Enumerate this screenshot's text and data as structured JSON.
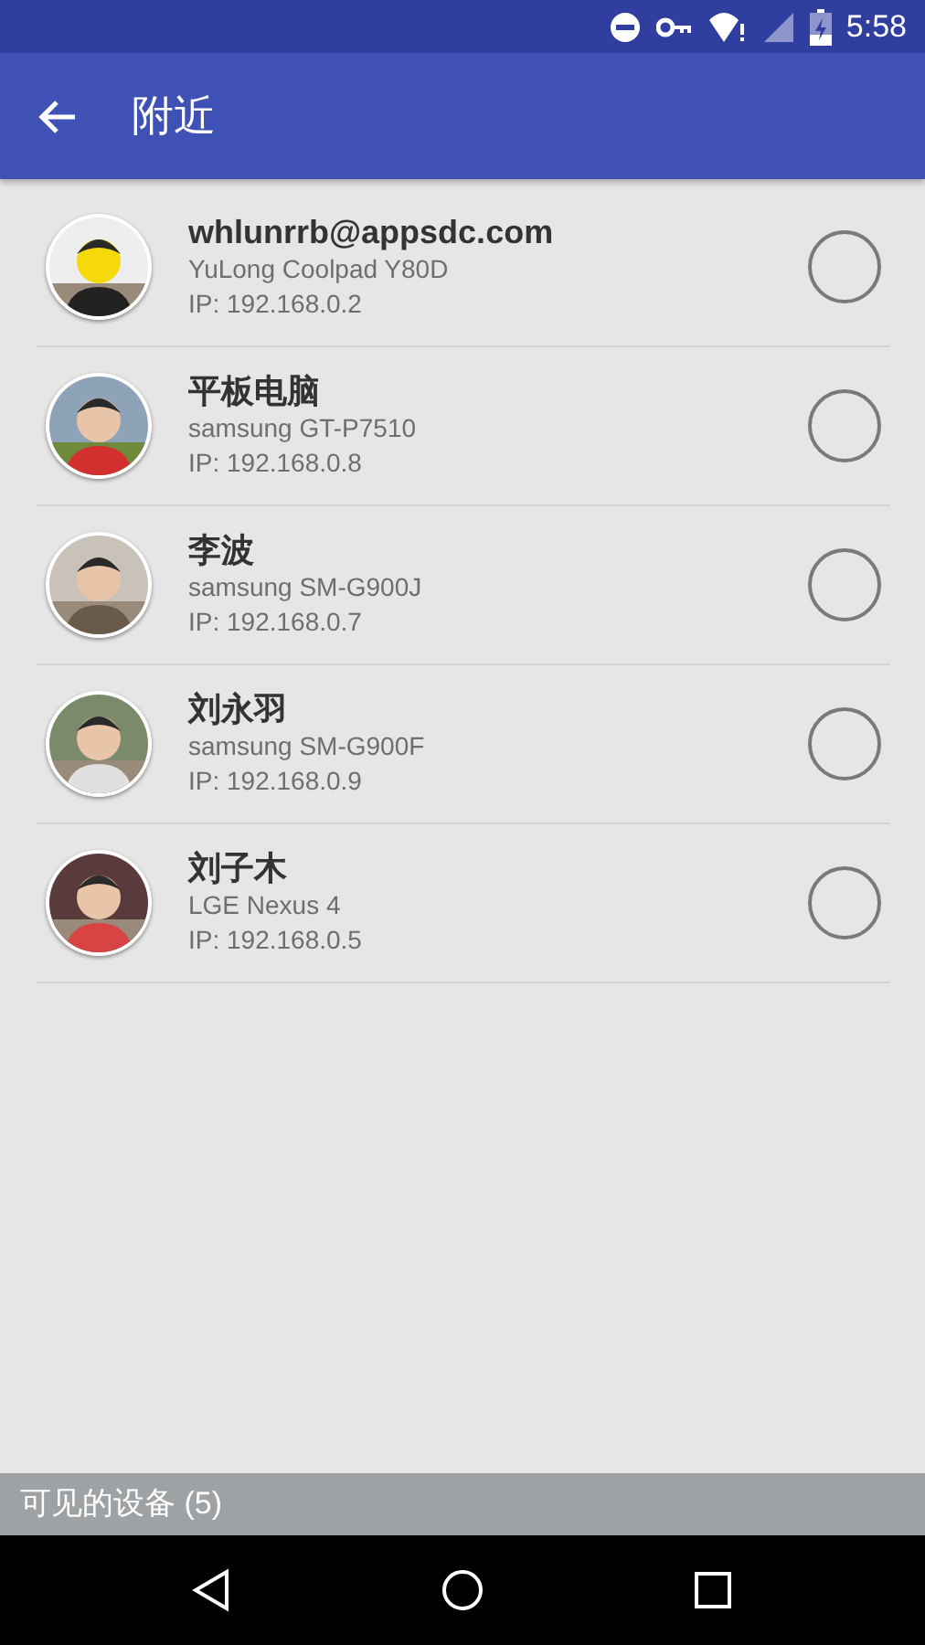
{
  "status_bar": {
    "time": "5:58"
  },
  "app_bar": {
    "title": "附近"
  },
  "devices": [
    {
      "name": "whlunrrb@appsdc.com",
      "model": "YuLong Coolpad Y80D",
      "ip": "IP: 192.168.0.2",
      "selected": false
    },
    {
      "name": "平板电脑",
      "model": "samsung GT-P7510",
      "ip": "IP: 192.168.0.8",
      "selected": false
    },
    {
      "name": "李波",
      "model": "samsung SM-G900J",
      "ip": "IP: 192.168.0.7",
      "selected": false
    },
    {
      "name": "刘永羽",
      "model": "samsung SM-G900F",
      "ip": "IP: 192.168.0.9",
      "selected": false
    },
    {
      "name": "刘子木",
      "model": "LGE Nexus 4",
      "ip": "IP: 192.168.0.5",
      "selected": false
    }
  ],
  "footer": {
    "label": "可见的设备 (5)"
  }
}
